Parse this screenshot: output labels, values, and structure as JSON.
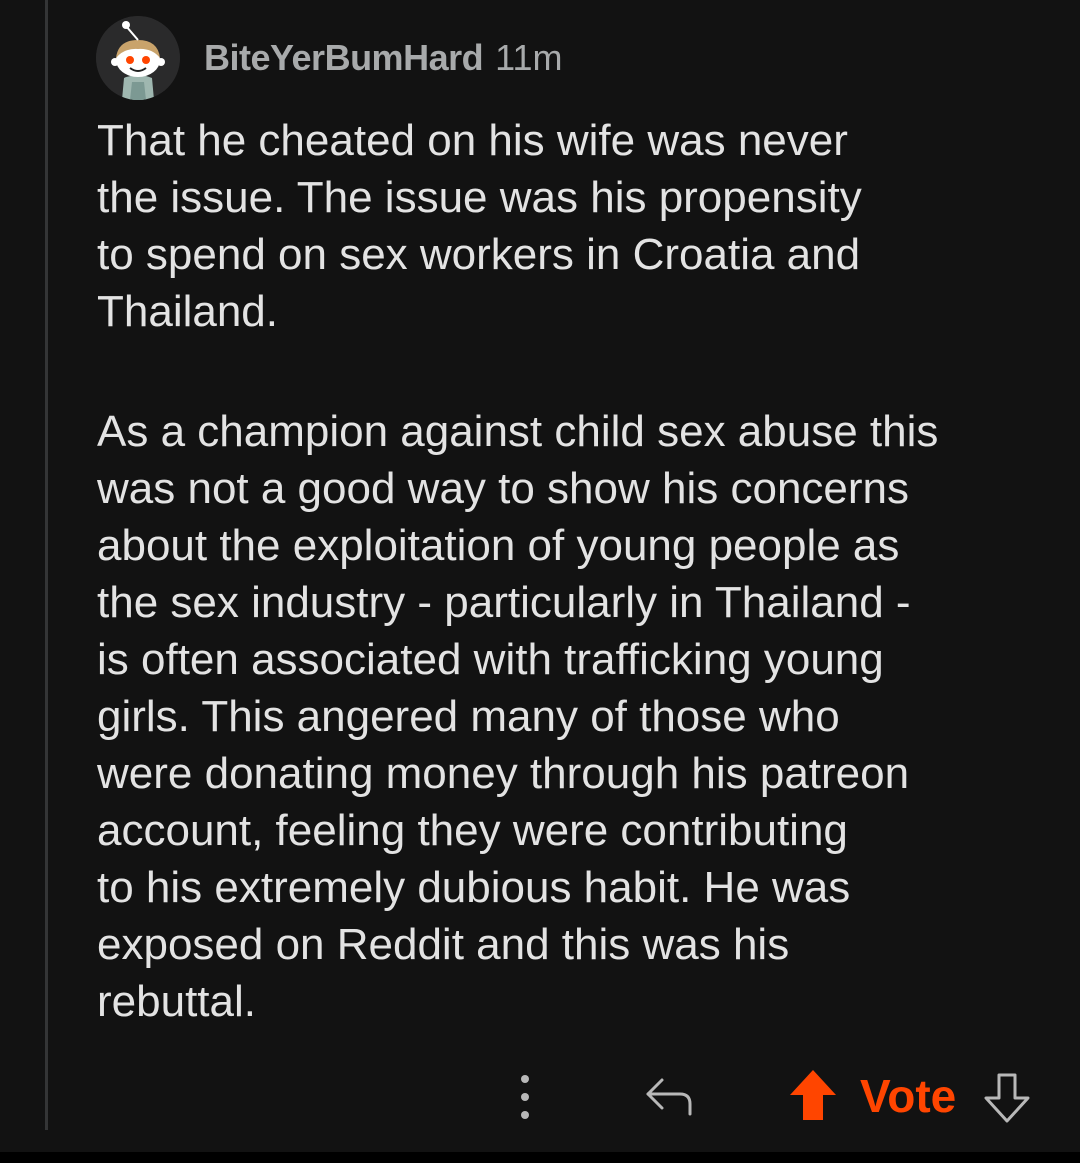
{
  "comment": {
    "author": "BiteYerBumHard",
    "age": "11m",
    "paragraphs": [
      "That he cheated on his wife was never\nthe issue. The issue was his propensity\nto spend on sex workers in Croatia and\nThailand.",
      "As a champion against child sex abuse this\nwas not a good way to show his concerns\nabout the exploitation of young people as\nthe sex industry - particularly in Thailand -\nis often associated with trafficking young\ngirls. This angered many of those who\nwere donating money through his patreon\naccount, feeling they were contributing\nto his extremely dubious habit. He was\nexposed on Reddit and this was his\nrebuttal."
    ]
  },
  "actions": {
    "vote_label": "Vote",
    "more_icon": "more-vertical-icon",
    "reply_icon": "reply-arrow-icon",
    "upvote_icon": "upvote-arrow-icon",
    "downvote_icon": "downvote-arrow-icon"
  },
  "colors": {
    "background": "#121212",
    "text": "#e3e3e3",
    "meta": "#a8aaab",
    "upvote_active": "#ff4500",
    "thread_line": "#343536"
  }
}
